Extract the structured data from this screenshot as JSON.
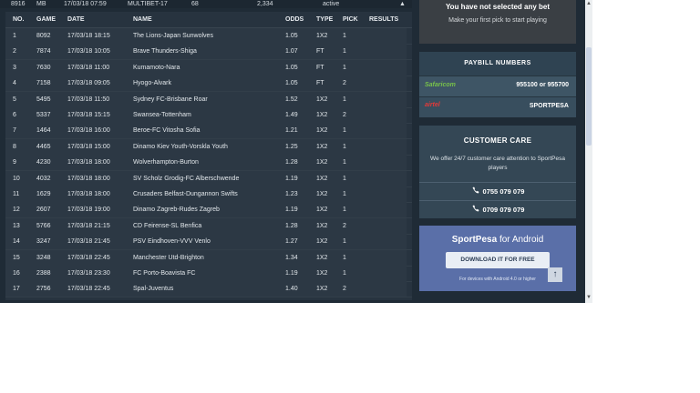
{
  "summary": {
    "id": "8916",
    "type": "MB",
    "date": "17/03/18 07:59",
    "bet": "MULTIBET-17",
    "stake": "68",
    "possible_win": "2,334",
    "status": "active",
    "caret": "▲"
  },
  "table": {
    "headers": {
      "no": "NO.",
      "game": "GAME",
      "date": "DATE",
      "name": "NAME",
      "odds": "ODDS",
      "type": "TYPE",
      "pick": "PICK",
      "results": "RESULTS"
    },
    "rows": [
      {
        "no": "1",
        "game": "8092",
        "date": "17/03/18 18:15",
        "name": "The Lions-Japan Sunwolves",
        "odds": "1.05",
        "type": "1X2",
        "pick": "1"
      },
      {
        "no": "2",
        "game": "7874",
        "date": "17/03/18 10:05",
        "name": "Brave Thunders-Shiga",
        "odds": "1.07",
        "type": "FT",
        "pick": "1"
      },
      {
        "no": "3",
        "game": "7630",
        "date": "17/03/18 11:00",
        "name": "Kumamoto-Nara",
        "odds": "1.05",
        "type": "FT",
        "pick": "1"
      },
      {
        "no": "4",
        "game": "7158",
        "date": "17/03/18 09:05",
        "name": "Hyogo-Alvark",
        "odds": "1.05",
        "type": "FT",
        "pick": "2"
      },
      {
        "no": "5",
        "game": "5495",
        "date": "17/03/18 11:50",
        "name": "Sydney FC-Brisbane Roar",
        "odds": "1.52",
        "type": "1X2",
        "pick": "1"
      },
      {
        "no": "6",
        "game": "5337",
        "date": "17/03/18 15:15",
        "name": "Swansea-Tottenham",
        "odds": "1.49",
        "type": "1X2",
        "pick": "2"
      },
      {
        "no": "7",
        "game": "1464",
        "date": "17/03/18 16:00",
        "name": "Beroe-FC Vitosha Sofia",
        "odds": "1.21",
        "type": "1X2",
        "pick": "1"
      },
      {
        "no": "8",
        "game": "4465",
        "date": "17/03/18 15:00",
        "name": "Dinamo Kiev Youth-Vorskla Youth",
        "odds": "1.25",
        "type": "1X2",
        "pick": "1"
      },
      {
        "no": "9",
        "game": "4230",
        "date": "17/03/18 18:00",
        "name": "Wolverhampton-Burton",
        "odds": "1.28",
        "type": "1X2",
        "pick": "1"
      },
      {
        "no": "10",
        "game": "4032",
        "date": "17/03/18 18:00",
        "name": "SV Scholz Grodig-FC Alberschwende",
        "odds": "1.19",
        "type": "1X2",
        "pick": "1"
      },
      {
        "no": "11",
        "game": "1629",
        "date": "17/03/18 18:00",
        "name": "Crusaders Belfast-Dungannon Swifts",
        "odds": "1.23",
        "type": "1X2",
        "pick": "1"
      },
      {
        "no": "12",
        "game": "2607",
        "date": "17/03/18 19:00",
        "name": "Dinamo Zagreb-Rudes Zagreb",
        "odds": "1.19",
        "type": "1X2",
        "pick": "1"
      },
      {
        "no": "13",
        "game": "5766",
        "date": "17/03/18 21:15",
        "name": "CD Feirense-SL Benfica",
        "odds": "1.28",
        "type": "1X2",
        "pick": "2"
      },
      {
        "no": "14",
        "game": "3247",
        "date": "17/03/18 21:45",
        "name": "PSV Eindhoven-VVV Venlo",
        "odds": "1.27",
        "type": "1X2",
        "pick": "1"
      },
      {
        "no": "15",
        "game": "3248",
        "date": "17/03/18 22:45",
        "name": "Manchester Utd-Brighton",
        "odds": "1.34",
        "type": "1X2",
        "pick": "1"
      },
      {
        "no": "16",
        "game": "2388",
        "date": "17/03/18 23:30",
        "name": "FC Porto-Boavista FC",
        "odds": "1.19",
        "type": "1X2",
        "pick": "1"
      },
      {
        "no": "17",
        "game": "2756",
        "date": "17/03/18 22:45",
        "name": "Spal-Juventus",
        "odds": "1.40",
        "type": "1X2",
        "pick": "2"
      }
    ]
  },
  "betslip": {
    "title": "You have not selected any bet",
    "subtitle": "Make your first pick to start playing"
  },
  "paybill": {
    "title": "PAYBILL NUMBERS",
    "safaricom_logo": "Safaricom",
    "safaricom_value": "955100 or 955700",
    "airtel_logo": "airtel",
    "airtel_value": "SPORTPESA"
  },
  "care": {
    "title": "CUSTOMER CARE",
    "desc": "We offer 24/7 customer care attention to SportPesa players",
    "phone1": "0755 079 079",
    "phone2": "0709 079 079",
    "phone_icon": "phone-icon"
  },
  "android": {
    "brand": "SportPesa",
    "suffix": "for Android",
    "button": "DOWNLOAD IT FOR FREE",
    "note": "For devices with  Android 4.0 or higher",
    "up": "↑"
  },
  "colors": {
    "background": "#1f2b36",
    "table": "#27333f",
    "accent": "#5a6fa8"
  }
}
